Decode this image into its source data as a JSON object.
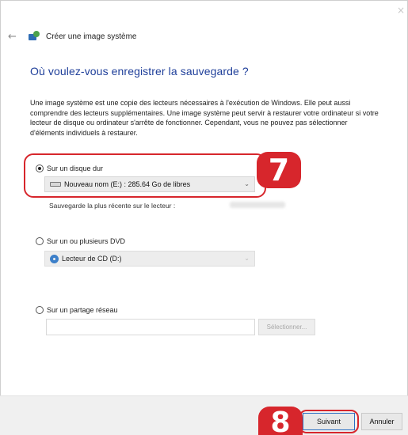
{
  "window": {
    "title": "Créer une image système",
    "back_glyph": "←",
    "close_glyph": "×"
  },
  "page": {
    "heading": "Où voulez-vous enregistrer la sauvegarde ?",
    "description": "Une image système est une copie des lecteurs nécessaires à l'exécution de Windows. Elle peut aussi comprendre des lecteurs supplémentaires. Une image système peut servir à restaurer votre ordinateur si votre lecteur de disque ou ordinateur s'arrête de fonctionner. Cependant, vous ne pouvez pas sélectionner d'éléments individuels à restaurer."
  },
  "options": {
    "hard_disk": {
      "label": "Sur un disque dur",
      "selected": true,
      "combo_value": "Nouveau nom (E:) : 285.64 Go de libres",
      "latest_label": "Sauvegarde la plus récente sur le lecteur :"
    },
    "dvd": {
      "label": "Sur un ou plusieurs DVD",
      "selected": false,
      "combo_value": "Lecteur de CD (D:)"
    },
    "network": {
      "label": "Sur un partage réseau",
      "selected": false,
      "path_value": "",
      "browse_label": "Sélectionner..."
    }
  },
  "footer": {
    "next_label": "Suivant",
    "cancel_label": "Annuler"
  },
  "callouts": {
    "step_a": "7",
    "step_b": "8"
  },
  "colors": {
    "heading": "#1f3f9a",
    "callout": "#d7262c",
    "focus_border": "#2b6fc2"
  },
  "icons": {
    "back": "back-arrow-icon",
    "app": "system-image-icon",
    "drive": "hard-drive-icon",
    "cd": "cd-drive-icon",
    "chevron": "chevron-down-icon"
  }
}
